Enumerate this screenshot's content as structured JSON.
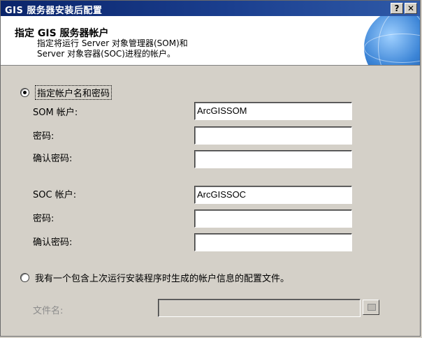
{
  "window": {
    "title": "GIS 服务器安装后配置",
    "help_glyph": "?",
    "close_glyph": "✕"
  },
  "header": {
    "title": "指定 GIS 服务器帐户",
    "desc_line1": "指定将运行 Server 对象管理器(SOM)和",
    "desc_line2": "Server 对象容器(SOC)进程的帐户。"
  },
  "options": {
    "specify_account": "指定帐户名和密码",
    "config_file": "我有一个包含上次运行安装程序时生成的帐户信息的配置文件。"
  },
  "som": {
    "account_label": "SOM 帐户:",
    "account_value": "ArcGISSOM",
    "password_label": "密码:",
    "confirm_label": "确认密码:"
  },
  "soc": {
    "account_label": "SOC 帐户:",
    "account_value": "ArcGISSOC",
    "password_label": "密码:",
    "confirm_label": "确认密码:"
  },
  "file": {
    "label": "文件名:",
    "value": ""
  },
  "icons": {
    "globe": "globe-icon",
    "browse": "folder-icon"
  }
}
